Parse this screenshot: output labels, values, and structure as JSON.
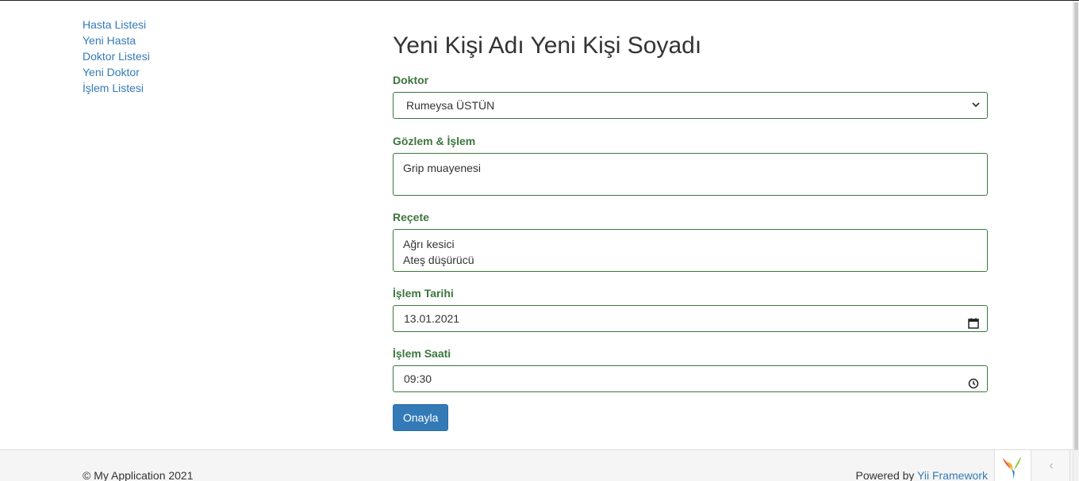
{
  "sidebar": {
    "items": [
      {
        "label": "Hasta Listesi"
      },
      {
        "label": "Yeni Hasta"
      },
      {
        "label": "Doktor Listesi"
      },
      {
        "label": "Yeni Doktor"
      },
      {
        "label": "İşlem Listesi"
      }
    ]
  },
  "form": {
    "title": "Yeni Kişi Adı Yeni Kişi Soyadı",
    "doctor_label": "Doktor",
    "doctor_value": "Rumeysa ÜSTÜN",
    "observation_label": "Gözlem & İşlem",
    "observation_value": "Grip muayenesi",
    "prescription_label": "Reçete",
    "prescription_value": "Ağrı kesici\nAteş düşürücü",
    "date_label": "İşlem Tarihi",
    "date_value": "13.01.2021",
    "time_label": "İşlem Saati",
    "time_value": "09:30",
    "submit_label": "Onayla"
  },
  "footer": {
    "copyright": "© My Application 2021",
    "powered_prefix": "Powered by",
    "powered_link": "Yii Framework"
  },
  "debug_toolbar": {
    "toggle_glyph": "‹"
  },
  "colors": {
    "link": "#337ab7",
    "success_label": "#3c763d",
    "button": "#337ab7"
  }
}
